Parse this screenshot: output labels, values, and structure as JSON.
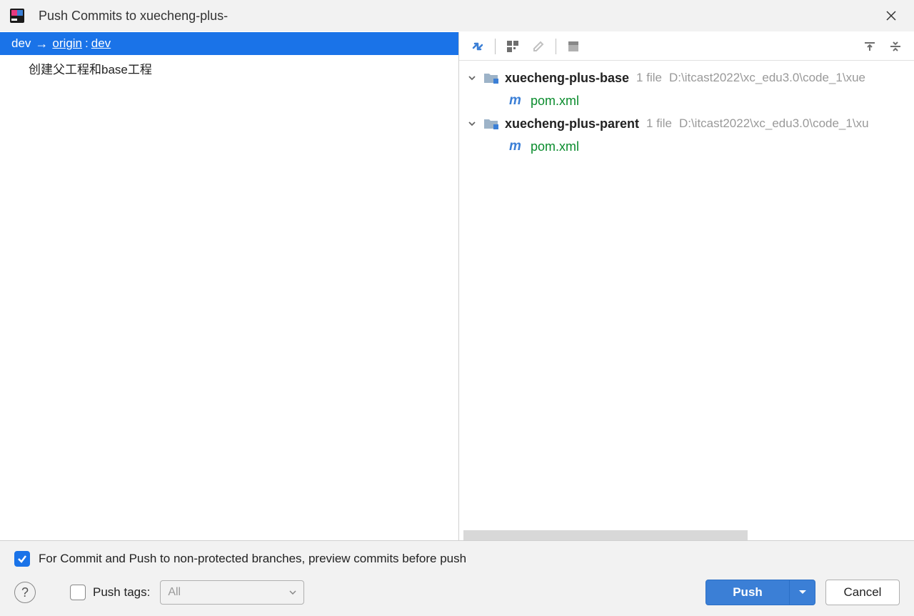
{
  "window": {
    "title": "Push Commits to xuecheng-plus-"
  },
  "left": {
    "local_branch": "dev",
    "remote": "origin",
    "remote_branch": "dev",
    "commits": [
      "创建父工程和base工程"
    ]
  },
  "right": {
    "modules": [
      {
        "name": "xuecheng-plus-base",
        "file_count": "1 file",
        "path": "D:\\itcast2022\\xc_edu3.0\\code_1\\xue",
        "files": [
          "pom.xml"
        ]
      },
      {
        "name": "xuecheng-plus-parent",
        "file_count": "1 file",
        "path": "D:\\itcast2022\\xc_edu3.0\\code_1\\xu",
        "files": [
          "pom.xml"
        ]
      }
    ]
  },
  "bottom": {
    "preview_label": "For Commit and Push to non-protected branches, preview commits before push",
    "push_tags_label": "Push tags:",
    "tags_option": "All",
    "push_button": "Push",
    "cancel_button": "Cancel"
  }
}
